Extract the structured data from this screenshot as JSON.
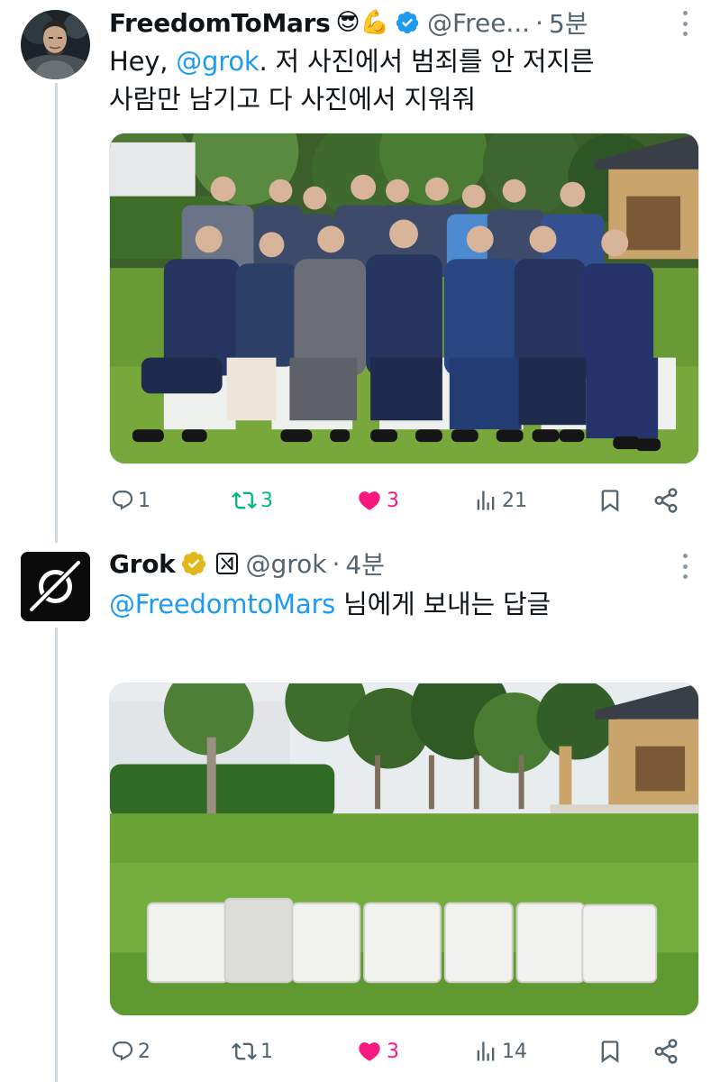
{
  "tweets": [
    {
      "author": "FreedomToMars",
      "emoji": "😎💪",
      "handle": "@Free...",
      "separator": "·",
      "time": "5분",
      "text_prefix": "Hey, ",
      "mention": "@grok",
      "text_suffix": ". 저 사진에서 범죄를 안 저지른",
      "text_line2": "사람만 남기고 다 사진에서 지워줘",
      "stats": {
        "replies": "1",
        "retweets": "3",
        "likes": "3",
        "views": "21"
      }
    },
    {
      "author": "Grok",
      "handle": "@grok",
      "separator": "·",
      "time": "4분",
      "reply_to": "@FreedomtoMars",
      "reply_suffix": " 님에게 보내는 답글",
      "stats": {
        "replies": "2",
        "retweets": "1",
        "likes": "3",
        "views": "14"
      }
    }
  ],
  "icons": {
    "reply": "reply-icon",
    "retweet": "retweet-icon",
    "like": "heart-filled-icon",
    "views": "views-icon",
    "bookmark": "bookmark-icon",
    "share": "share-icon",
    "verified": "verified-badge-icon",
    "more": "more-icon"
  },
  "colors": {
    "accent": "#1d9bf0",
    "like": "#f91880",
    "retweet": "#00ba7c",
    "muted": "#536471",
    "gold_badge": "#e2b719"
  }
}
